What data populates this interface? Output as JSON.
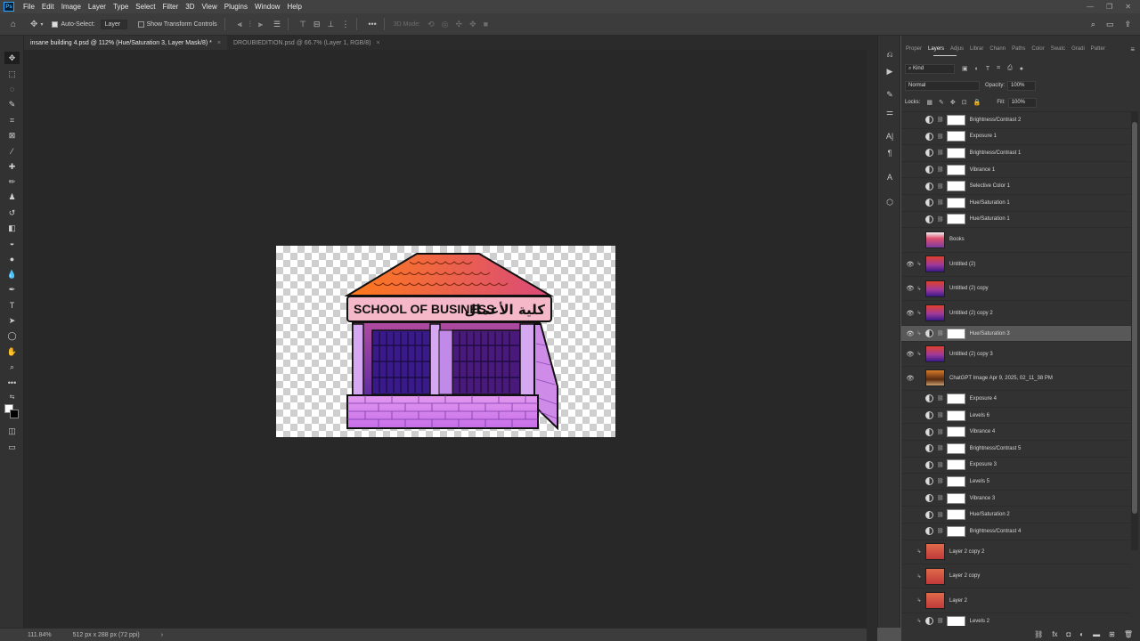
{
  "app": {
    "logo": "Ps"
  },
  "menu": [
    "File",
    "Edit",
    "Image",
    "Layer",
    "Type",
    "Select",
    "Filter",
    "3D",
    "View",
    "Plugins",
    "Window",
    "Help"
  ],
  "window_controls": {
    "minimize": "—",
    "restore": "❐",
    "close": "✕"
  },
  "options": {
    "auto_select_label": "Auto-Select:",
    "auto_select_target": "Layer",
    "transform_controls_label": "Show Transform Controls",
    "mode_3d_label": "3D Mode:",
    "more_label": "•••"
  },
  "tabs": [
    {
      "label": "insane building 4.psd @ 112% (Hue/Saturation 3, Layer Mask/8) *",
      "close": "×"
    },
    {
      "label": "DROUBIEDITION.psd @ 66.7% (Layer 1, RGB/8)",
      "close": "×"
    }
  ],
  "canvas_art": {
    "sign_text": "SCHOOL OF BUSINESS",
    "sign_arabic": "كلية الأعمال"
  },
  "status": {
    "zoom": "111.84%",
    "doc_size": "512 px x 288 px (72 ppi)",
    "arrow": "›"
  },
  "panel": {
    "tabs": [
      "Proper",
      "Layers",
      "Adjus",
      "Librar",
      "Chann",
      "Paths",
      "Color",
      "Swatc",
      "Gradi",
      "Patter"
    ],
    "active_tab": "Layers",
    "filter_kind": "Kind",
    "blend_mode": "Normal",
    "opacity_label": "Opacity:",
    "opacity_value": "100%",
    "locks_label": "Locks:",
    "fill_label": "Fill:",
    "fill_value": "100%"
  },
  "layers": [
    {
      "name": "Brightness/Contrast 2",
      "type": "adj",
      "visible": false
    },
    {
      "name": "Exposure 1",
      "type": "adj",
      "visible": false
    },
    {
      "name": "Brightness/Contrast 1",
      "type": "adj",
      "visible": false
    },
    {
      "name": "Vibrance 1",
      "type": "adj",
      "visible": false
    },
    {
      "name": "Selective Color 1",
      "type": "adj",
      "visible": false
    },
    {
      "name": "Hue/Saturation 1",
      "type": "adj",
      "visible": false
    },
    {
      "name": "Hue/Saturation 1",
      "type": "adj",
      "visible": false
    },
    {
      "name": "Books",
      "type": "pixel",
      "visible": false,
      "thumb": "books"
    },
    {
      "name": "Untitled (2)",
      "type": "pixel",
      "visible": true,
      "clip": true,
      "thumb": "purple"
    },
    {
      "name": "Untitled (2) copy",
      "type": "pixel",
      "visible": true,
      "clip": true,
      "thumb": "purple"
    },
    {
      "name": "Untitled (2) copy 2",
      "type": "pixel",
      "visible": true,
      "clip": true,
      "thumb": "purple"
    },
    {
      "name": "Hue/Saturation 3",
      "type": "adj",
      "visible": true,
      "clip": true,
      "selected": true
    },
    {
      "name": "Untitled (2) copy 3",
      "type": "pixel",
      "visible": true,
      "clip": true,
      "thumb": "purple"
    },
    {
      "name": "ChatGPT Image Apr 9, 2025, 02_11_38 PM",
      "type": "pixel",
      "visible": true,
      "thumb": "building"
    },
    {
      "name": "Exposure 4",
      "type": "adj",
      "visible": false
    },
    {
      "name": "Levels 6",
      "type": "adj",
      "visible": false
    },
    {
      "name": "Vibrance 4",
      "type": "adj",
      "visible": false
    },
    {
      "name": "Brightness/Contrast 5",
      "type": "adj",
      "visible": false
    },
    {
      "name": "Exposure 3",
      "type": "adj",
      "visible": false
    },
    {
      "name": "Levels 5",
      "type": "adj",
      "visible": false
    },
    {
      "name": "Vibrance 3",
      "type": "adj",
      "visible": false
    },
    {
      "name": "Hue/Saturation 2",
      "type": "adj",
      "visible": false
    },
    {
      "name": "Brightness/Contrast 4",
      "type": "adj",
      "visible": false
    },
    {
      "name": "Layer 2 copy 2",
      "type": "pixel",
      "visible": false,
      "clip": true,
      "thumb": "red"
    },
    {
      "name": "Layer 2 copy",
      "type": "pixel",
      "visible": false,
      "clip": true,
      "thumb": "red"
    },
    {
      "name": "Layer 2",
      "type": "pixel",
      "visible": false,
      "clip": true,
      "thumb": "red"
    },
    {
      "name": "Levels 2",
      "type": "adj",
      "visible": false,
      "clip": true
    }
  ],
  "colors": {
    "accent": "#31a8ff",
    "canvas_bg": "#282828",
    "panel_bg": "#323232",
    "selected_row": "#585858"
  }
}
